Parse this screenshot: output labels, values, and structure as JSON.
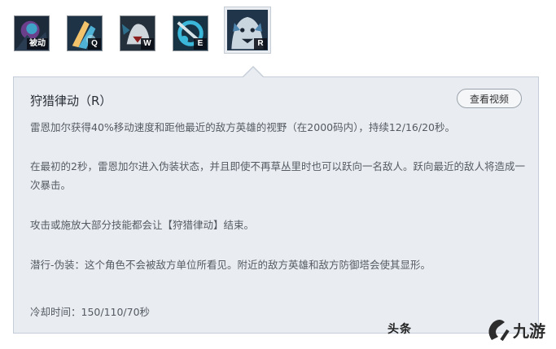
{
  "skills": [
    {
      "key": "被动",
      "icon": "passive-skill-icon",
      "colors": [
        "#1d2a3a",
        "#3fa3c8",
        "#6b3f8a"
      ]
    },
    {
      "key": "Q",
      "icon": "q-skill-icon",
      "colors": [
        "#1f3347",
        "#4fb1d6",
        "#f2c36b"
      ]
    },
    {
      "key": "W",
      "icon": "w-skill-icon",
      "colors": [
        "#24303c",
        "#cfd6dc",
        "#2f6f8e"
      ]
    },
    {
      "key": "E",
      "icon": "e-skill-icon",
      "colors": [
        "#173243",
        "#3ab7d9",
        "#d8e3e8"
      ]
    },
    {
      "key": "R",
      "icon": "r-skill-icon",
      "colors": [
        "#20344a",
        "#c9d5df",
        "#4e86b0"
      ]
    }
  ],
  "panel": {
    "title": "狩猎律动（R）",
    "video_button": "查看视频",
    "paragraphs": [
      "雷恩加尔获得40%移动速度和距他最近的敌方英雄的视野（在2000码内），持续12/16/20秒。",
      "在最初的2秒，雷恩加尔进入伪装状态，并且即使不再草丛里时也可以跃向一名敌人。跃向最近的敌人将造成一次暴击。",
      "攻击或施放大部分技能都会让【狩猎律动】结束。",
      "潜行-伪装：这个角色不会被敌方单位所看见。附近的敌方英雄和敌方防御塔会使其显形。"
    ],
    "cooldown": "冷却时间：150/110/70秒"
  },
  "watermark": {
    "text": "头条",
    "logo_text": "九游"
  }
}
